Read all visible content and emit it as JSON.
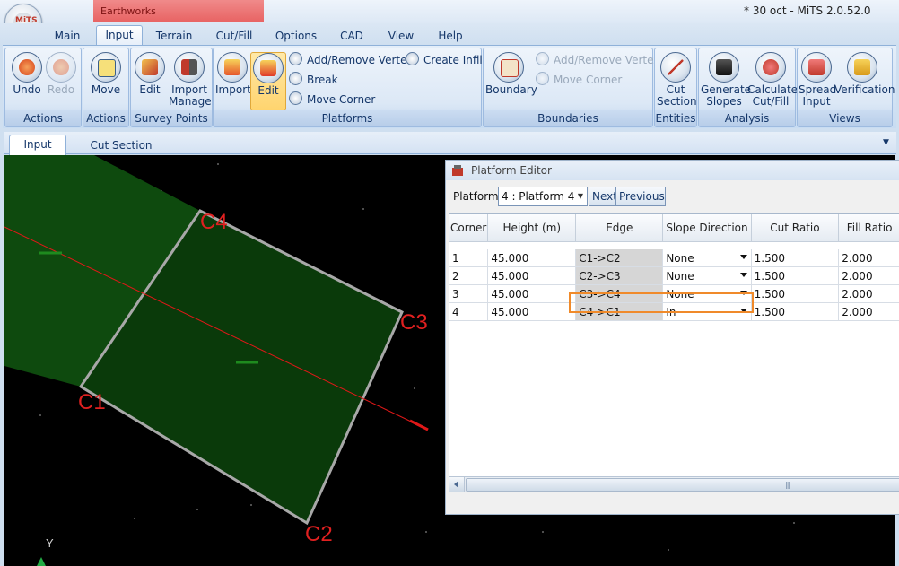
{
  "window": {
    "title": "* 30 oct - MiTS 2.0.52.0",
    "context_tab": "Earthworks",
    "app_logo": "MiTS"
  },
  "ribbon_tabs": [
    "Main",
    "Input",
    "Terrain",
    "Cut/Fill",
    "Options",
    "CAD",
    "View",
    "Help"
  ],
  "active_ribbon_tab": "Input",
  "groups": {
    "actions1": {
      "label": "Actions",
      "undo": "Undo",
      "redo": "Redo"
    },
    "actions2": {
      "label": "Actions",
      "move": "Move"
    },
    "survey_points": {
      "label": "Survey Points",
      "edit": "Edit",
      "import_line1": "Import",
      "import_line2": "Manage"
    },
    "platforms": {
      "label": "Platforms",
      "import": "Import",
      "edit": "Edit",
      "add_remove_vertex": "Add/Remove Vertex",
      "break": "Break",
      "move_corner": "Move Corner",
      "create_infill": "Create Infill"
    },
    "boundaries": {
      "label": "Boundaries",
      "boundary": "Boundary",
      "add_remove_vertex": "Add/Remove Vertex",
      "move_corner": "Move Corner"
    },
    "entities": {
      "label": "Entities",
      "cut_line1": "Cut",
      "cut_line2": "Section"
    },
    "analysis": {
      "label": "Analysis",
      "generate_line1": "Generate",
      "generate_line2": "Slopes",
      "calculate_line1": "Calculate",
      "calculate_line2": "Cut/Fill"
    },
    "views": {
      "label": "Views",
      "spread_line1": "Spread",
      "spread_line2": "Input",
      "verification": "Verification"
    }
  },
  "doc_tabs": [
    "Input",
    "Cut Section"
  ],
  "viewport": {
    "corner_labels": [
      "C1",
      "C2",
      "C3",
      "C4"
    ],
    "axis_label": "Y",
    "colors": {
      "platform_fill": "#0a3a0a",
      "platform_edge": "#a8a8a8",
      "label": "#e02020",
      "center_line": "#e01818",
      "background": "#000000"
    }
  },
  "editor": {
    "title": "Platform Editor",
    "platform_label": "Platform",
    "platform_value": "4 : Platform 4",
    "next": "Next",
    "previous": "Previous",
    "columns": [
      "Corner",
      "Height (m)",
      "Edge",
      "Slope Direction",
      "Cut Ratio",
      "Fill Ratio"
    ],
    "rows": [
      {
        "corner": "1",
        "height": "45.000",
        "edge": "C1->C2",
        "slope": "None",
        "cut": "1.500",
        "fill": "2.000"
      },
      {
        "corner": "2",
        "height": "45.000",
        "edge": "C2->C3",
        "slope": "None",
        "cut": "1.500",
        "fill": "2.000"
      },
      {
        "corner": "3",
        "height": "45.000",
        "edge": "C3->C4",
        "slope": "None",
        "cut": "1.500",
        "fill": "2.000"
      },
      {
        "corner": "4",
        "height": "45.000",
        "edge": "C4->C1",
        "slope": "In",
        "cut": "1.500",
        "fill": "2.000"
      }
    ],
    "highlight_color": "#f08a2a"
  }
}
